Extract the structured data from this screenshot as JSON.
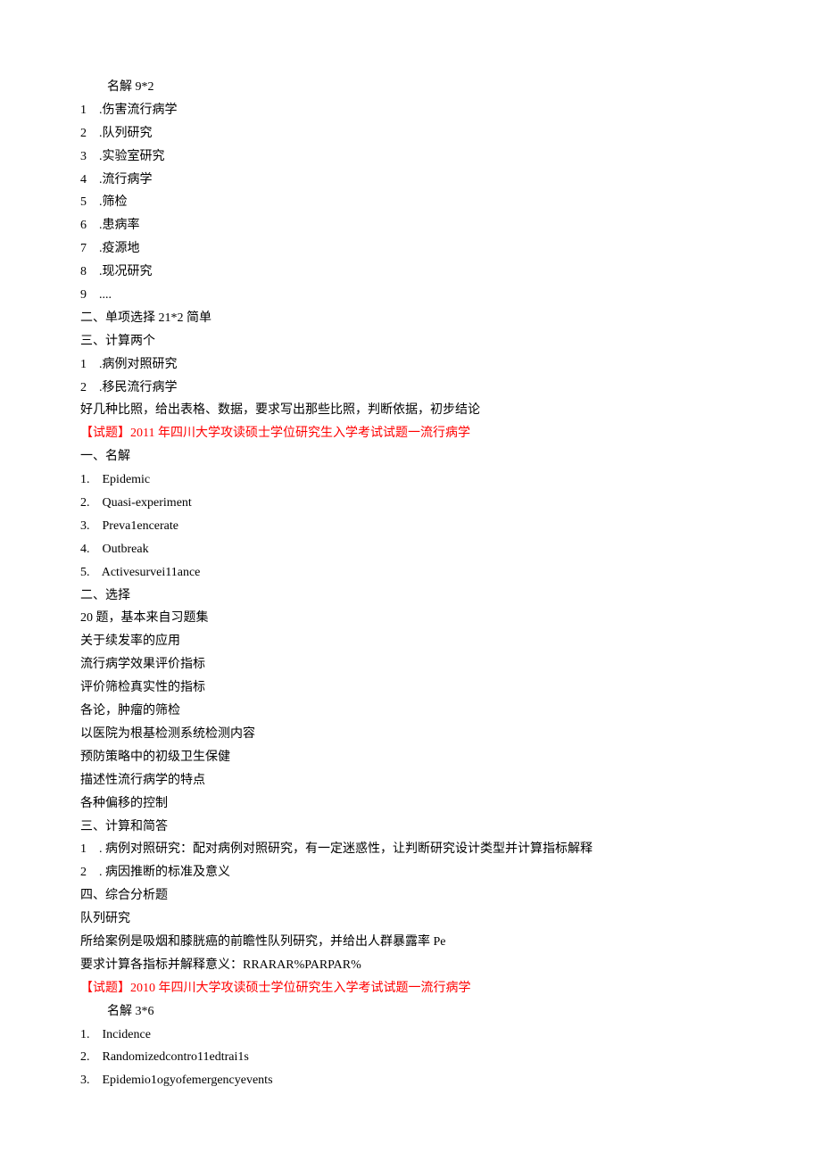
{
  "lines": [
    {
      "text": "名解 9*2",
      "indent": true,
      "red": false
    },
    {
      "text": "1    .伤害流行病学",
      "indent": false,
      "red": false
    },
    {
      "text": "2    .队列研究",
      "indent": false,
      "red": false
    },
    {
      "text": "3    .实验室研究",
      "indent": false,
      "red": false
    },
    {
      "text": "4    .流行病学",
      "indent": false,
      "red": false
    },
    {
      "text": "5    .筛检",
      "indent": false,
      "red": false
    },
    {
      "text": "6    .患病率",
      "indent": false,
      "red": false
    },
    {
      "text": "7    .疫源地",
      "indent": false,
      "red": false
    },
    {
      "text": "8    .现况研究",
      "indent": false,
      "red": false
    },
    {
      "text": "9    ....",
      "indent": false,
      "red": false
    },
    {
      "text": "二、单项选择 21*2 简单",
      "indent": false,
      "red": false
    },
    {
      "text": "三、计算两个",
      "indent": false,
      "red": false
    },
    {
      "text": "1    .病例对照研究",
      "indent": false,
      "red": false
    },
    {
      "text": "2    .移民流行病学",
      "indent": false,
      "red": false
    },
    {
      "text": "好几种比照，给出表格、数据，要求写出那些比照，判断依据，初步结论",
      "indent": false,
      "red": false
    },
    {
      "text": "【试题】2011 年四川大学攻读硕士学位研究生入学考试试题一流行病学",
      "indent": false,
      "red": true
    },
    {
      "text": "一、名解",
      "indent": false,
      "red": false
    },
    {
      "text": "1.    Epidemic",
      "indent": false,
      "red": false
    },
    {
      "text": "2.    Quasi-experiment",
      "indent": false,
      "red": false
    },
    {
      "text": "3.    Preva1encerate",
      "indent": false,
      "red": false
    },
    {
      "text": "4.    Outbreak",
      "indent": false,
      "red": false
    },
    {
      "text": "5.    Activesurvei11ance",
      "indent": false,
      "red": false
    },
    {
      "text": "二、选择",
      "indent": false,
      "red": false
    },
    {
      "text": "20 题，基本来自习题集",
      "indent": false,
      "red": false
    },
    {
      "text": "关于续发率的应用",
      "indent": false,
      "red": false
    },
    {
      "text": "流行病学效果评价指标",
      "indent": false,
      "red": false
    },
    {
      "text": "评价筛检真实性的指标",
      "indent": false,
      "red": false
    },
    {
      "text": "各论，肿瘤的筛检",
      "indent": false,
      "red": false
    },
    {
      "text": "以医院为根基检测系统检测内容",
      "indent": false,
      "red": false
    },
    {
      "text": "预防策略中的初级卫生保健",
      "indent": false,
      "red": false
    },
    {
      "text": "描述性流行病学的特点",
      "indent": false,
      "red": false
    },
    {
      "text": "各种偏移的控制",
      "indent": false,
      "red": false
    },
    {
      "text": "三、计算和简答",
      "indent": false,
      "red": false
    },
    {
      "text": "1    . 病例对照研究：配对病例对照研究，有一定迷惑性，让判断研究设计类型并计算指标解释",
      "indent": false,
      "red": false
    },
    {
      "text": "2    . 病因推断的标准及意义",
      "indent": false,
      "red": false
    },
    {
      "text": "四、综合分析题",
      "indent": false,
      "red": false
    },
    {
      "text": "队列研究",
      "indent": false,
      "red": false
    },
    {
      "text": "所给案例是吸烟和膝胱癌的前瞻性队列研究，并给出人群暴露率 Pe",
      "indent": false,
      "red": false
    },
    {
      "text": "要求计算各指标并解释意义：RRARAR%PARPAR%",
      "indent": false,
      "red": false
    },
    {
      "text": "【试题】2010 年四川大学攻读硕士学位研究生入学考试试题一流行病学",
      "indent": false,
      "red": true
    },
    {
      "text": "名解 3*6",
      "indent": true,
      "red": false
    },
    {
      "text": "1.    Incidence",
      "indent": false,
      "red": false
    },
    {
      "text": "2.    Randomizedcontro11edtrai1s",
      "indent": false,
      "red": false
    },
    {
      "text": "3.    Epidemio1ogyofemergencyevents",
      "indent": false,
      "red": false
    }
  ]
}
